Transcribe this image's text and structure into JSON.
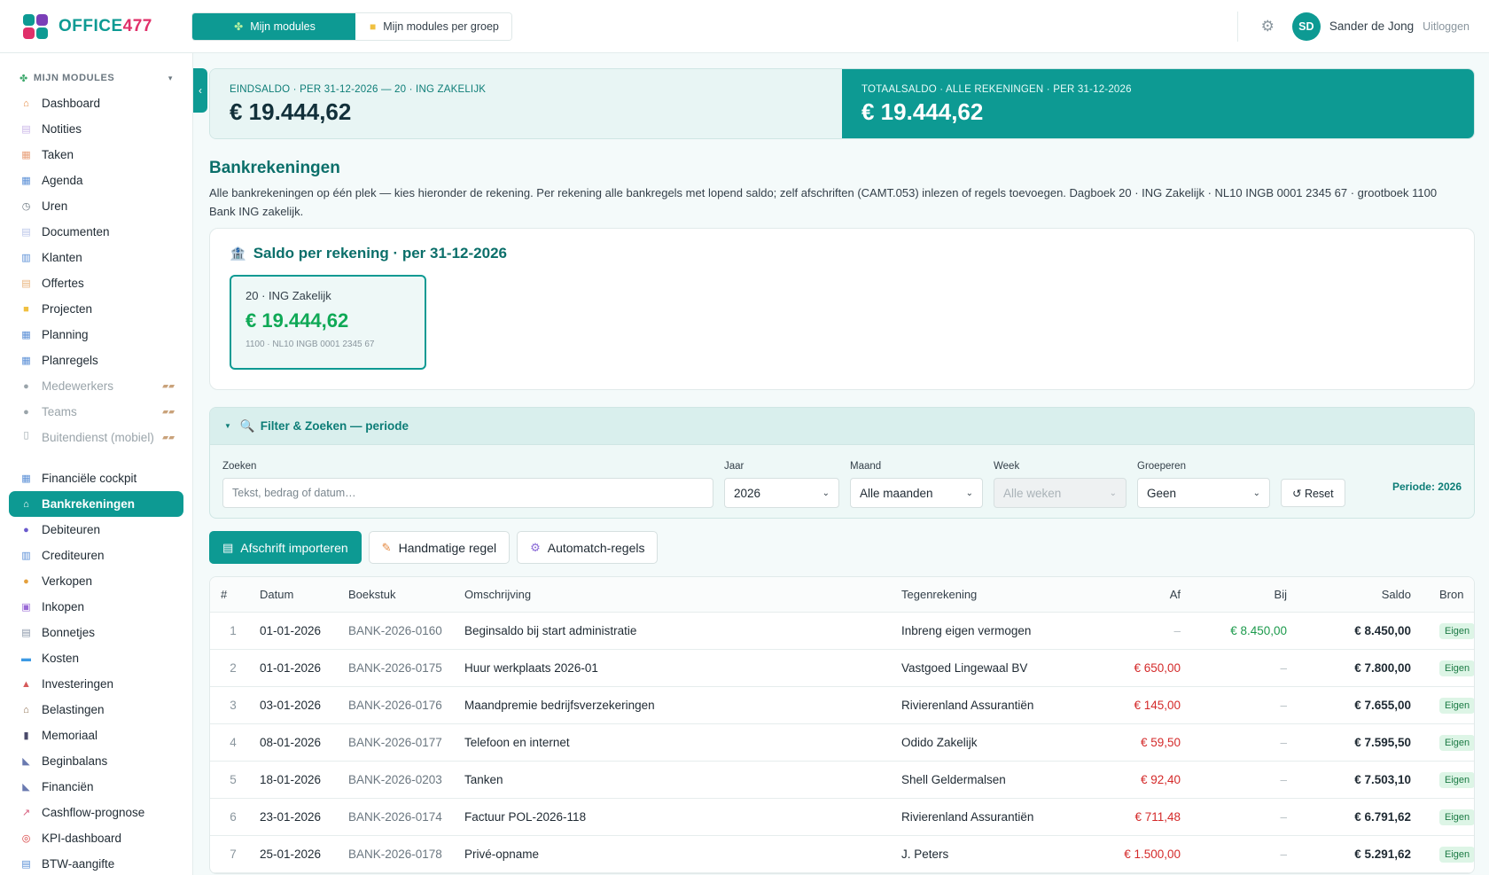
{
  "app": {
    "logo_prefix": "OFFICE",
    "logo_suffix": "477",
    "brand_color": "#0d9a93"
  },
  "topbar": {
    "tabs": [
      {
        "label": "Mijn modules",
        "icon": "puzzle-icon",
        "active": true
      },
      {
        "label": "Mijn modules per groep",
        "icon": "folder-icon",
        "active": false
      }
    ],
    "user": {
      "initials": "SD",
      "name": "Sander de Jong",
      "logout": "Uitloggen"
    }
  },
  "sidebar": {
    "heading": "MIJN MODULES",
    "items": [
      {
        "label": "Dashboard",
        "icon": "house-icon",
        "color": "#e4873d"
      },
      {
        "label": "Notities",
        "icon": "note-icon",
        "color": "#c9b6e8"
      },
      {
        "label": "Taken",
        "icon": "clipboard-icon",
        "color": "#e8a07a"
      },
      {
        "label": "Agenda",
        "icon": "calendar-icon",
        "color": "#5a8fd6"
      },
      {
        "label": "Uren",
        "icon": "clock-icon",
        "color": "#6b7780"
      },
      {
        "label": "Documenten",
        "icon": "document-icon",
        "color": "#b9c4e8"
      },
      {
        "label": "Klanten",
        "icon": "building-icon",
        "color": "#5a8fd6"
      },
      {
        "label": "Offertes",
        "icon": "page-icon",
        "color": "#e8b27a"
      },
      {
        "label": "Projecten",
        "icon": "folder-icon",
        "color": "#f0c040"
      },
      {
        "label": "Planning",
        "icon": "calendar-icon",
        "color": "#5a8fd6"
      },
      {
        "label": "Planregels",
        "icon": "calendar-icon",
        "color": "#5a8fd6"
      },
      {
        "label": "Medewerkers",
        "icon": "person-icon",
        "color": "#9aa4aa",
        "locked": true
      },
      {
        "label": "Teams",
        "icon": "people-icon",
        "color": "#9aa4aa",
        "locked": true
      },
      {
        "label": "Buitendienst (mobiel)",
        "icon": "phone-icon",
        "color": "#9aa4aa",
        "locked": true
      },
      {
        "label": "Financiële cockpit",
        "icon": "grid-icon",
        "color": "#5a8fd6"
      },
      {
        "label": "Bankrekeningen",
        "icon": "bank-icon",
        "color": "#ffffff",
        "active": true
      },
      {
        "label": "Debiteuren",
        "icon": "people-icon",
        "color": "#6a5acd"
      },
      {
        "label": "Crediteuren",
        "icon": "building-icon",
        "color": "#5a8fd6"
      },
      {
        "label": "Verkopen",
        "icon": "money-bag-icon",
        "color": "#e4a03d"
      },
      {
        "label": "Inkopen",
        "icon": "inbox-icon",
        "color": "#9a6ad6"
      },
      {
        "label": "Bonnetjes",
        "icon": "receipt-icon",
        "color": "#8a96a8"
      },
      {
        "label": "Kosten",
        "icon": "banknote-icon",
        "color": "#3d9ae4"
      },
      {
        "label": "Investeringen",
        "icon": "chart-icon",
        "color": "#d65a5a"
      },
      {
        "label": "Belastingen",
        "icon": "bank-icon",
        "color": "#8a6a4a"
      },
      {
        "label": "Memoriaal",
        "icon": "book-icon",
        "color": "#4a4a6a"
      },
      {
        "label": "Beginbalans",
        "icon": "ruler-icon",
        "color": "#6a7ab0"
      },
      {
        "label": "Financiën",
        "icon": "ruler-icon",
        "color": "#6a7ab0"
      },
      {
        "label": "Cashflow-prognose",
        "icon": "trend-icon",
        "color": "#d65a7a"
      },
      {
        "label": "KPI-dashboard",
        "icon": "target-icon",
        "color": "#d63a3a"
      },
      {
        "label": "BTW-aangifte",
        "icon": "document-icon",
        "color": "#5a8fd6"
      }
    ]
  },
  "balances": [
    {
      "label": "EINDSALDO · PER 31-12-2026 — 20 · ING ZAKELIJK",
      "amount": "€ 19.444,62"
    },
    {
      "label": "TOTAALSALDO · ALLE REKENINGEN · PER 31-12-2026",
      "amount": "€ 19.444,62"
    }
  ],
  "page": {
    "title": "Bankrekeningen",
    "intro": "Alle bankrekeningen op één plek — kies hieronder de rekening. Per rekening alle bankregels met lopend saldo; zelf afschriften (CAMT.053) inlezen of regels toevoegen. Dagboek 20 · ING Zakelijk · NL10 INGB 0001 2345 67 · grootboek 1100 Bank ING zakelijk."
  },
  "saldo_card": {
    "title": "Saldo per rekening · per 31-12-2026",
    "account": {
      "name": "20 · ING Zakelijk",
      "amount": "€ 19.444,62",
      "sub": "1100 · NL10 INGB 0001 2345 67"
    }
  },
  "filter": {
    "title": "Filter & Zoeken — periode",
    "search_label": "Zoeken",
    "search_placeholder": "Tekst, bedrag of datum…",
    "year_label": "Jaar",
    "year_value": "2026",
    "month_label": "Maand",
    "month_value": "Alle maanden",
    "week_label": "Week",
    "week_value": "Alle weken",
    "group_label": "Groeperen",
    "group_value": "Geen",
    "reset_label": "↺ Reset",
    "periode": "Periode: 2026"
  },
  "actions": [
    {
      "label": "Afschrift importeren",
      "icon": "document-icon"
    },
    {
      "label": "Handmatige regel",
      "icon": "pencil-icon"
    },
    {
      "label": "Automatch-regels",
      "icon": "gear-icon"
    }
  ],
  "table": {
    "headers": [
      "#",
      "Datum",
      "Boekstuk",
      "Omschrijving",
      "Tegenrekening",
      "Af",
      "Bij",
      "Saldo",
      "Bron"
    ],
    "rows": [
      {
        "n": "1",
        "datum": "01-01-2026",
        "boekstuk": "BANK-2026-0160",
        "omschrijving": "Beginsaldo bij start administratie",
        "tegenrekening": "Inbreng eigen vermogen",
        "af": "–",
        "bij": "€ 8.450,00",
        "saldo": "€ 8.450,00",
        "bron": "Eigen"
      },
      {
        "n": "2",
        "datum": "01-01-2026",
        "boekstuk": "BANK-2026-0175",
        "omschrijving": "Huur werkplaats 2026-01",
        "tegenrekening": "Vastgoed Lingewaal BV",
        "af": "€ 650,00",
        "bij": "–",
        "saldo": "€ 7.800,00",
        "bron": "Eigen"
      },
      {
        "n": "3",
        "datum": "03-01-2026",
        "boekstuk": "BANK-2026-0176",
        "omschrijving": "Maandpremie bedrijfsverzekeringen",
        "tegenrekening": "Rivierenland Assurantiën",
        "af": "€ 145,00",
        "bij": "–",
        "saldo": "€ 7.655,00",
        "bron": "Eigen"
      },
      {
        "n": "4",
        "datum": "08-01-2026",
        "boekstuk": "BANK-2026-0177",
        "omschrijving": "Telefoon en internet",
        "tegenrekening": "Odido Zakelijk",
        "af": "€ 59,50",
        "bij": "–",
        "saldo": "€ 7.595,50",
        "bron": "Eigen"
      },
      {
        "n": "5",
        "datum": "18-01-2026",
        "boekstuk": "BANK-2026-0203",
        "omschrijving": "Tanken",
        "tegenrekening": "Shell Geldermalsen",
        "af": "€ 92,40",
        "bij": "–",
        "saldo": "€ 7.503,10",
        "bron": "Eigen"
      },
      {
        "n": "6",
        "datum": "23-01-2026",
        "boekstuk": "BANK-2026-0174",
        "omschrijving": "Factuur POL-2026-118",
        "tegenrekening": "Rivierenland Assurantiën",
        "af": "€ 711,48",
        "bij": "–",
        "saldo": "€ 6.791,62",
        "bron": "Eigen"
      },
      {
        "n": "7",
        "datum": "25-01-2026",
        "boekstuk": "BANK-2026-0178",
        "omschrijving": "Privé-opname",
        "tegenrekening": "J. Peters",
        "af": "€ 1.500,00",
        "bij": "–",
        "saldo": "€ 5.291,62",
        "bron": "Eigen"
      }
    ]
  }
}
